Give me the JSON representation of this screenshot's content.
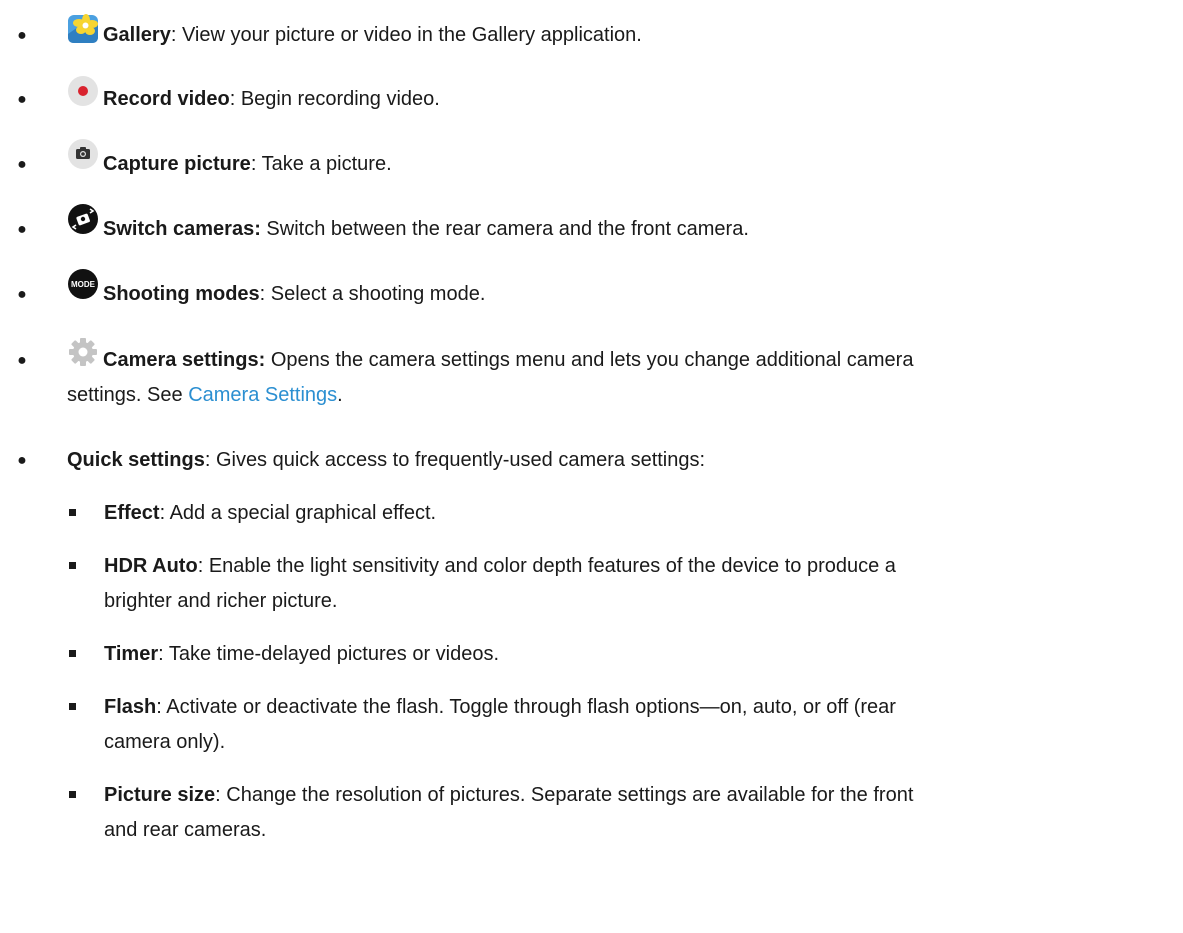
{
  "items": [
    {
      "title": "Gallery",
      "sep": ": ",
      "desc": "View your picture or video in the Gallery application.",
      "icon": "gallery-icon"
    },
    {
      "title": "Record video",
      "sep": ": ",
      "desc": "Begin recording video.",
      "icon": "record-video-icon"
    },
    {
      "title": "Capture picture",
      "sep": ": ",
      "desc": "Take a picture.",
      "icon": "capture-picture-icon"
    },
    {
      "title": "Switch cameras:",
      "sep": " ",
      "desc": "Switch between the rear camera and the front camera.",
      "icon": "switch-cameras-icon"
    },
    {
      "title": "Shooting modes",
      "sep": ": ",
      "desc": "Select a shooting mode.",
      "icon": "mode-icon",
      "icon_text": "MODE"
    },
    {
      "title": "Camera settings:",
      "sep": " ",
      "desc_line1": "Opens the camera settings menu and lets you change additional camera",
      "desc_line2_prefix": "settings. See ",
      "link": "Camera Settings",
      "desc_line2_suffix": ".",
      "icon": "gear-icon"
    },
    {
      "title": "Quick settings",
      "sep": ": ",
      "desc": "Gives quick access to frequently-used camera settings:"
    }
  ],
  "subitems": [
    {
      "title": "Effect",
      "sep": ": ",
      "desc": "Add a special graphical effect."
    },
    {
      "title": "HDR Auto",
      "sep": ": ",
      "desc_line1": "Enable the light sensitivity and color depth features of the device to produce a",
      "desc_line2": "brighter and richer picture."
    },
    {
      "title": "Timer",
      "sep": ": ",
      "desc": "Take time-delayed pictures or videos."
    },
    {
      "title": "Flash",
      "sep": ": ",
      "desc_line1": "Activate or deactivate the flash. Toggle through flash options—on, auto, or off (rear",
      "desc_line2": "camera only)."
    },
    {
      "title": "Picture size",
      "sep": ": ",
      "desc_line1": "Change the resolution of pictures. Separate settings are available for the front",
      "desc_line2": "and rear cameras."
    }
  ],
  "bullet_glyph": "●",
  "colors": {
    "link": "#2b8fd1",
    "record_dot": "#d9232e",
    "gallery_bg": "#4ba0e0",
    "gallery_flower": "#f7d531"
  }
}
